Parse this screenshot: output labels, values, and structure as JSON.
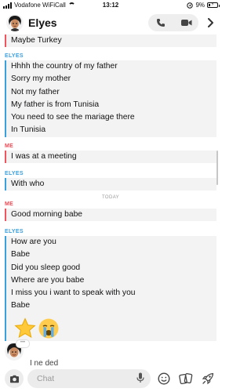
{
  "status_bar": {
    "carrier": "Vodafone WiFiCall",
    "time": "13:12",
    "battery": "9%",
    "icons": [
      "signal-icon",
      "wifi-icon",
      "location-icon",
      "battery-icon"
    ]
  },
  "header": {
    "name": "Elyes",
    "icons": [
      "bitmoji-avatar",
      "phone-icon",
      "video-icon",
      "chevron-right-icon"
    ]
  },
  "labels": {
    "me": "ME",
    "them": "ELYES",
    "today": "TODAY"
  },
  "colors": {
    "me": "#f0555f",
    "them": "#3a9fdd",
    "bubble_bg": "#f3f3f4"
  },
  "messages": {
    "g0": {
      "lines": [
        "Maybe Turkey"
      ]
    },
    "g1": {
      "lines": [
        "Hhhh the country of my father",
        "Sorry my mother",
        "Not my father",
        "My father is from Tunisia",
        "You need to see the mariage there",
        "In Tunisia"
      ]
    },
    "g2": {
      "lines": [
        "I was at a meeting"
      ]
    },
    "g3": {
      "lines": [
        "With who"
      ]
    },
    "g4": {
      "lines": [
        "Good morning babe"
      ]
    },
    "g5": {
      "lines": [
        "How are you",
        "Babe",
        "Did you sleep good",
        "Where are you babe",
        "I miss you i want to speak with you",
        "Babe"
      ],
      "emojis": [
        "star-emoji",
        "crying-face-emoji"
      ]
    }
  },
  "typing": {
    "indicator": "•••",
    "partial_text": "I ne ded"
  },
  "input": {
    "placeholder": "Chat",
    "value": ""
  },
  "bottom_bar": {
    "icons": [
      "camera-icon",
      "microphone-icon",
      "smile-icon",
      "cards-icon",
      "rocket-icon"
    ]
  }
}
